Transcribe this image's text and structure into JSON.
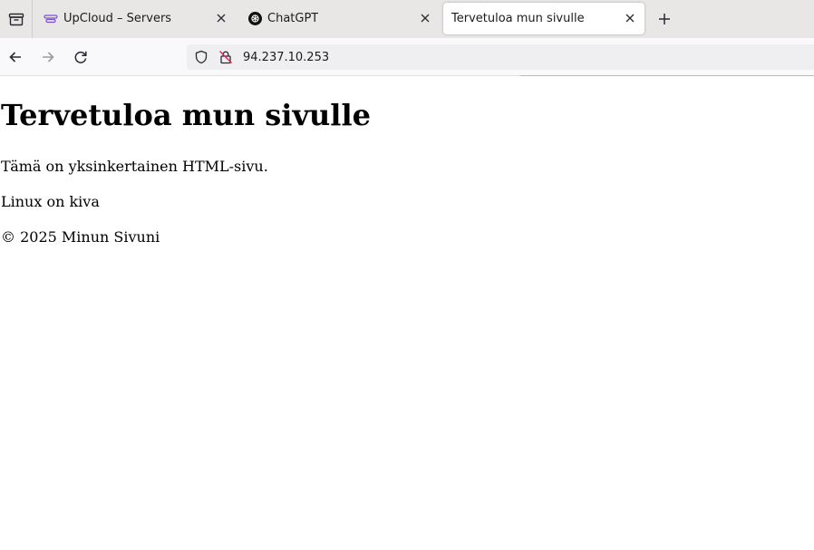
{
  "browser": {
    "tabs": [
      {
        "title": "UpCloud – Servers",
        "favicon": "upcloud-icon",
        "active": false
      },
      {
        "title": "ChatGPT",
        "favicon": "chatgpt-icon",
        "active": false
      },
      {
        "title": "Tervetuloa mun sivulle",
        "favicon": "",
        "active": true
      }
    ],
    "url": "94.237.10.253",
    "colors": {
      "tabstrip": "#e8e7e6",
      "navbar": "#f9f9fb",
      "urlbar": "#efeff1",
      "warning": "#e22850"
    }
  },
  "page": {
    "heading": "Tervetuloa mun sivulle",
    "paragraphs": [
      "Tämä on yksinkertainen HTML-sivu.",
      "Linux on kiva",
      "© 2025 Minun Sivuni"
    ]
  }
}
